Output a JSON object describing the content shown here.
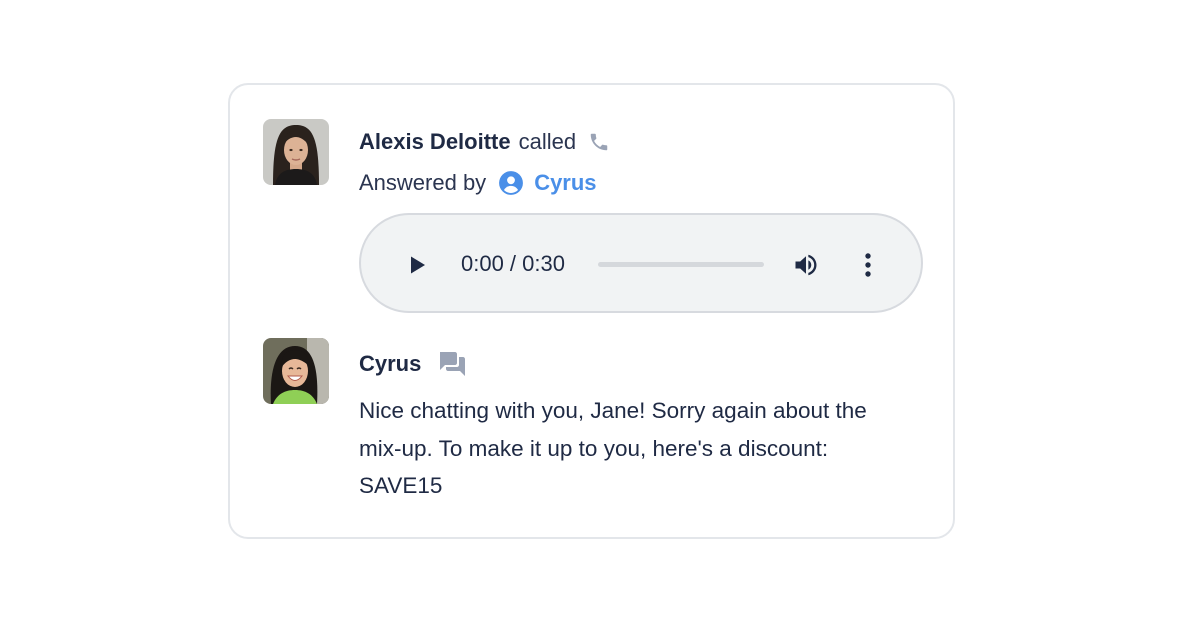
{
  "call": {
    "caller_name": "Alexis Deloitte",
    "action_text": "called",
    "answered_label": "Answered by",
    "answerer_name": "Cyrus"
  },
  "audio": {
    "time_text": "0:00 / 0:30",
    "progress_fraction": 0
  },
  "message": {
    "sender_name": "Cyrus",
    "text": "Nice chatting with you, Jane! Sorry again about the mix-up. To make it up to you, here's a discount: SAVE15"
  },
  "icons": {
    "phone": "phone-icon",
    "user": "user-circle-icon",
    "play": "play-icon",
    "volume": "volume-icon",
    "menu": "more-vertical-icon",
    "chat": "chat-bubbles-icon"
  },
  "colors": {
    "accent": "#4a8fe8",
    "text": "#1f2a44",
    "icon_gray": "#9aa3b5",
    "player_bg": "#f1f3f4",
    "card_border": "#e3e6ea"
  }
}
